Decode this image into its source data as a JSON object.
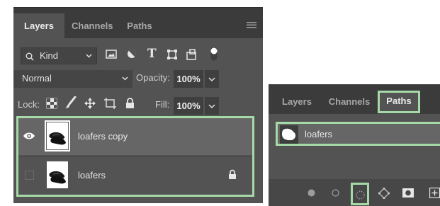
{
  "left_panel": {
    "tabs": [
      {
        "label": "Layers",
        "active": true
      },
      {
        "label": "Channels",
        "active": false
      },
      {
        "label": "Paths",
        "active": false
      }
    ],
    "filter": {
      "label": "Kind"
    },
    "blend_mode": "Normal",
    "opacity_label": "Opacity:",
    "opacity_value": "100%",
    "lock_label": "Lock:",
    "fill_label": "Fill:",
    "fill_value": "100%",
    "layers": [
      {
        "name": "loafers copy",
        "visible": true,
        "selected": true
      },
      {
        "name": "loafers",
        "visible": false,
        "locked": true
      }
    ]
  },
  "right_panel": {
    "tabs": [
      {
        "label": "Layers",
        "active": false
      },
      {
        "label": "Channels",
        "active": false
      },
      {
        "label": "Paths",
        "active": true
      }
    ],
    "paths": [
      {
        "name": "loafers"
      }
    ],
    "footer_icons": [
      "fill-path-icon",
      "stroke-path-icon",
      "load-selection-icon",
      "make-work-path-icon",
      "add-mask-icon",
      "new-path-icon"
    ]
  },
  "colors": {
    "highlight": "#a5d9a7",
    "panel_bg": "#535353",
    "tab_bar_bg": "#3b3b3b"
  }
}
